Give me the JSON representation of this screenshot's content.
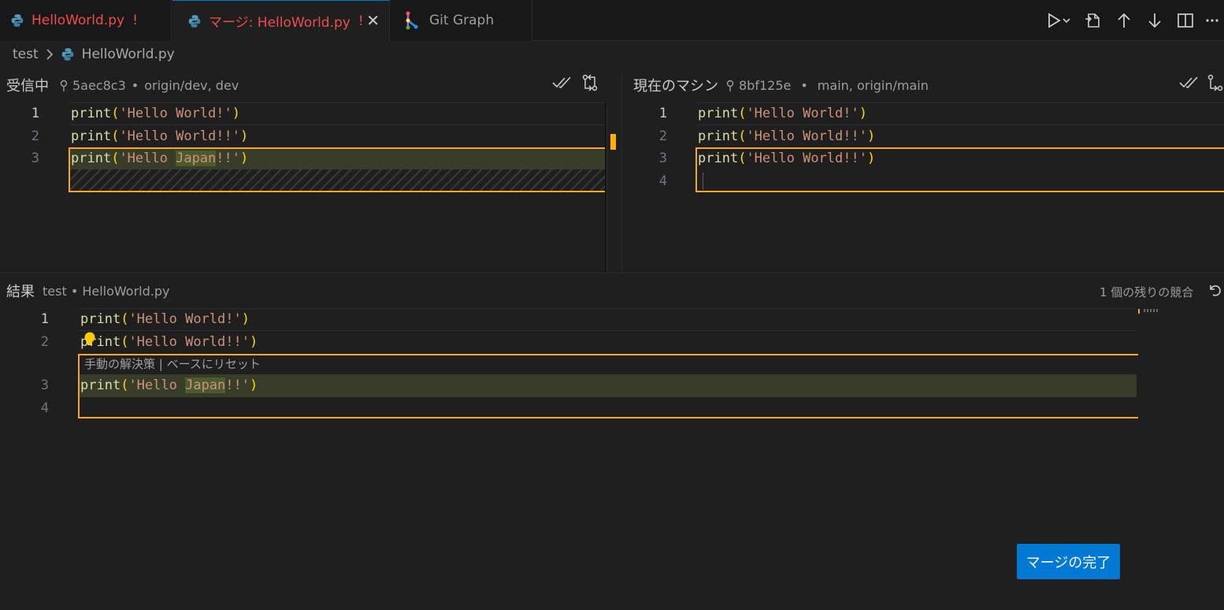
{
  "tabs": [
    {
      "label": "HelloWorld.py",
      "modified": "!"
    },
    {
      "label": "マージ: HelloWorld.py",
      "modified": "!",
      "close": "✕"
    },
    {
      "label": "Git Graph"
    }
  ],
  "breadcrumb": {
    "folder": "test",
    "file": "HelloWorld.py"
  },
  "incoming": {
    "title": "受信中",
    "commit": "5aec8c3",
    "refs": "origin/dev, dev",
    "lines": [
      {
        "num": "1",
        "fn": "print",
        "open": "(",
        "str": "'Hello World!'",
        "close": ")"
      },
      {
        "num": "2",
        "fn": "print",
        "open": "(",
        "str": "'Hello World!!'",
        "close": ")"
      },
      {
        "num": "3",
        "fn": "print",
        "open": "(",
        "str_a": "'Hello ",
        "str_b": "Japan",
        "str_c": "!!'",
        "close": ")"
      }
    ]
  },
  "current": {
    "title": "現在のマシン",
    "commit": "8bf125e",
    "refs": "main, origin/main",
    "lines": [
      {
        "num": "1",
        "fn": "print",
        "open": "(",
        "str": "'Hello World!'",
        "close": ")"
      },
      {
        "num": "2",
        "fn": "print",
        "open": "(",
        "str": "'Hello World!!'",
        "close": ")"
      },
      {
        "num": "3",
        "fn": "print",
        "open": "(",
        "str": "'Hello World!!'",
        "close": ")"
      },
      {
        "num": "4"
      }
    ]
  },
  "result": {
    "title": "結果",
    "path": "test • HelloWorld.py",
    "remaining": "1 個の残りの競合",
    "codelens": {
      "manual": "手動の解決策",
      "sep": " | ",
      "reset": "ベースにリセット"
    },
    "lines": [
      {
        "num": "1",
        "fn": "print",
        "open": "(",
        "str": "'Hello World!'",
        "close": ")"
      },
      {
        "num": "2",
        "fn": "print",
        "open": "(",
        "str": "'Hello World!!'",
        "close": ")"
      },
      {
        "num": "3",
        "fn": "print",
        "open": "(",
        "str_a": "'Hello ",
        "str_b": "Japan",
        "str_c": "!!'",
        "close": ")"
      },
      {
        "num": "4"
      }
    ]
  },
  "complete_button": "マージの完了",
  "colors": {
    "accent": "#0078d4",
    "conflict": "#f5a623",
    "modified_tab": "#f14c4c"
  }
}
